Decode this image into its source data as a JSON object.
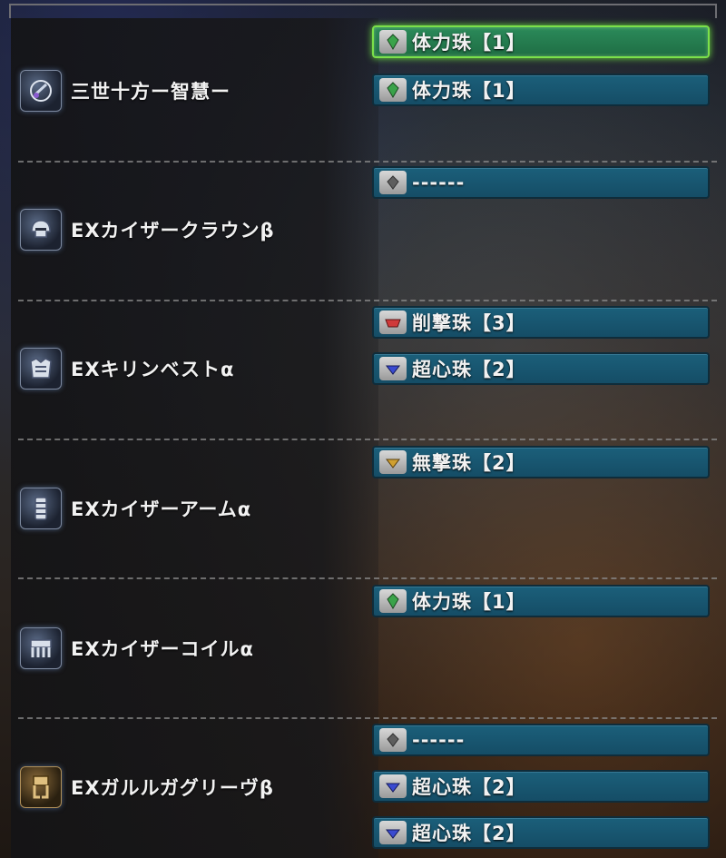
{
  "rows": [
    {
      "armor": {
        "name": "三世十方ー智慧ー",
        "icon": "talisman-icon"
      },
      "slots": [
        {
          "label": "体力珠【1】",
          "gem": "green",
          "gem_color": "#3aa34a",
          "selected": true
        },
        {
          "label": "体力珠【1】",
          "gem": "green",
          "gem_color": "#3aa34a",
          "selected": false
        }
      ]
    },
    {
      "armor": {
        "name": "EXカイザークラウンβ",
        "icon": "helm-icon"
      },
      "slots": [
        {
          "label": "------",
          "gem": "empty",
          "gem_color": "#9a9a9a",
          "selected": false
        }
      ]
    },
    {
      "armor": {
        "name": "EXキリンベストα",
        "icon": "chest-armor-icon"
      },
      "slots": [
        {
          "label": "削撃珠【3】",
          "gem": "red",
          "gem_color": "#d03a3a",
          "selected": false
        },
        {
          "label": "超心珠【2】",
          "gem": "blue",
          "gem_color": "#3a4ad0",
          "selected": false
        }
      ]
    },
    {
      "armor": {
        "name": "EXカイザーアームα",
        "icon": "arm-armor-icon"
      },
      "slots": [
        {
          "label": "無撃珠【2】",
          "gem": "yellow",
          "gem_color": "#d0a030",
          "selected": false
        }
      ]
    },
    {
      "armor": {
        "name": "EXカイザーコイルα",
        "icon": "waist-armor-icon"
      },
      "slots": [
        {
          "label": "体力珠【1】",
          "gem": "green",
          "gem_color": "#3aa34a",
          "selected": false
        }
      ]
    },
    {
      "armor": {
        "name": "EXガルルガグリーヴβ",
        "icon": "leg-armor-icon"
      },
      "slots": [
        {
          "label": "------",
          "gem": "empty",
          "gem_color": "#9a9a9a",
          "selected": false
        },
        {
          "label": "超心珠【2】",
          "gem": "blue",
          "gem_color": "#3a4ad0",
          "selected": false
        },
        {
          "label": "超心珠【2】",
          "gem": "blue",
          "gem_color": "#3a4ad0",
          "selected": false
        }
      ]
    }
  ]
}
